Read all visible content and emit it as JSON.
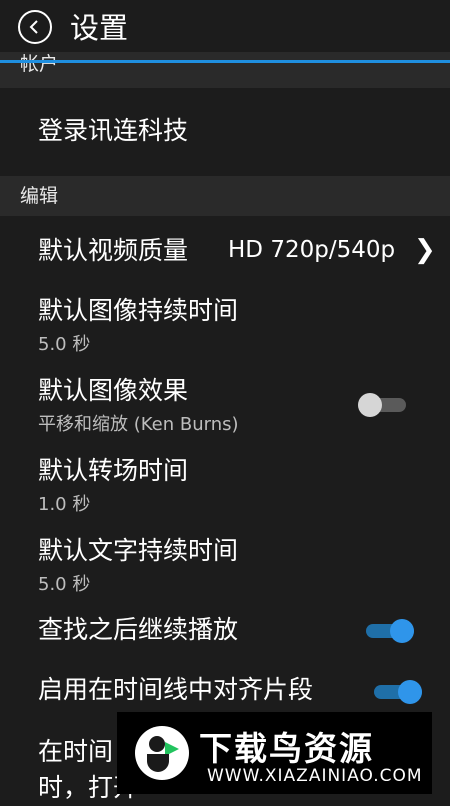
{
  "header": {
    "title": "设置",
    "back_icon": "back-arrow-icon",
    "accent_color": "#1f8fe0"
  },
  "sections": {
    "account": {
      "label": "帐户"
    },
    "edit": {
      "label": "编辑"
    }
  },
  "account": {
    "login_label": "登录讯连科技"
  },
  "settings": {
    "video_quality": {
      "label": "默认视频质量",
      "value": "HD 720p/540p",
      "icon": "chevron-right-icon"
    },
    "image_duration": {
      "label": "默认图像持续时间",
      "value": "5.0 秒"
    },
    "image_effect": {
      "label": "默认图像效果",
      "value": "平移和缩放 (Ken Burns)",
      "enabled": false
    },
    "transition_duration": {
      "label": "默认转场时间",
      "value": "1.0 秒"
    },
    "text_duration": {
      "label": "默认文字持续时间",
      "value": "5.0 秒"
    },
    "continue_after_find": {
      "label": "查找之后继续播放",
      "enabled": true
    },
    "snap_timeline": {
      "label": "启用在时间线中对齐片段",
      "enabled": true
    },
    "partial": {
      "line1": "在时间",
      "line2": "时，打开"
    }
  },
  "watermark": {
    "title": "下载鸟资源",
    "url": "WWW.XIAZAINIAO.COM",
    "logo_icon": "bird-logo-icon"
  }
}
